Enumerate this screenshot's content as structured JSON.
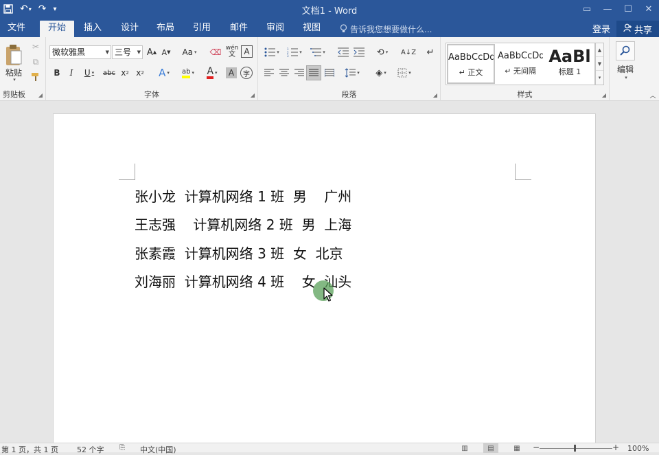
{
  "window": {
    "title": "文档1 - Word",
    "qat": {
      "save_icon": "save-icon",
      "undo_icon": "undo-icon",
      "redo_icon": "redo-icon",
      "customize_icon": "customize-qat-icon"
    }
  },
  "tabs": [
    "文件",
    "开始",
    "插入",
    "设计",
    "布局",
    "引用",
    "邮件",
    "审阅",
    "视图"
  ],
  "active_tab": "开始",
  "tell_me": "告诉我您想要做什么...",
  "account": {
    "login": "登录",
    "share": "共享"
  },
  "ribbon": {
    "clipboard": {
      "paste": "粘贴",
      "label": "剪贴板"
    },
    "font": {
      "font_name": "微软雅黑",
      "font_size": "三号",
      "label": "字体",
      "case_label": "Aa",
      "phonetic_label": "wén"
    },
    "paragraph": {
      "label": "段落"
    },
    "styles": {
      "label": "样式",
      "items": [
        {
          "sample": "AaBbCcDd",
          "name": "↵ 正文"
        },
        {
          "sample": "AaBbCcDd",
          "name": "↵ 无间隔"
        },
        {
          "sample": "AaBl",
          "name": "标题 1"
        }
      ]
    },
    "editing": {
      "label": "编辑"
    }
  },
  "document": {
    "lines": [
      "张小龙  计算机网络 1 班  男    广州",
      "王志强    计算机网络 2 班  男  上海",
      "张素霞  计算机网络 3 班  女  北京",
      "刘海丽  计算机网络 4 班    女  汕头"
    ]
  },
  "status": {
    "page": "第 1 页，共 1 页",
    "words": "52 个字",
    "language": "中文(中国)",
    "zoom": "100%"
  },
  "colors": {
    "brand": "#2b579a",
    "ribbon_bg": "#f3f3f3",
    "doc_bg": "#e6e6e6"
  }
}
